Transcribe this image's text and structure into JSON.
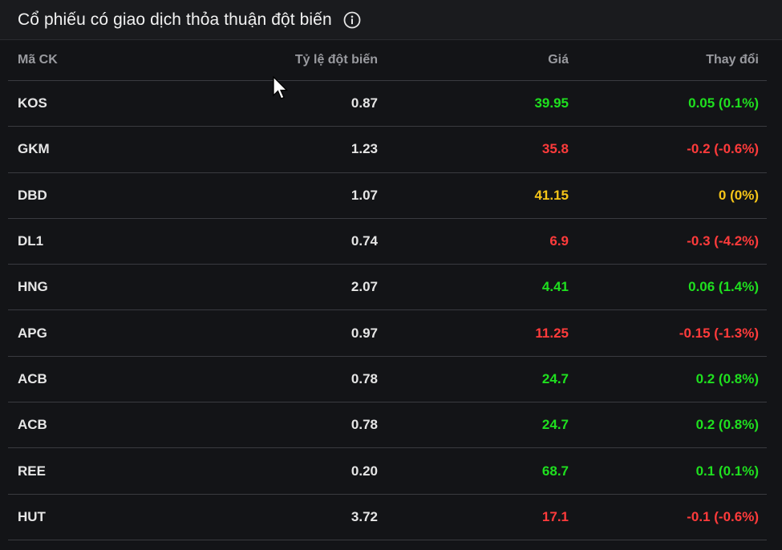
{
  "header": {
    "title": "Cổ phiếu có giao dịch thỏa thuận đột biến"
  },
  "columns": {
    "symbol": "Mã CK",
    "ratio": "Tỷ lệ đột biến",
    "price": "Giá",
    "change": "Thay đổi"
  },
  "colors": {
    "up": "#1fe01f",
    "down": "#ff3b3b",
    "reference": "#f5c518"
  },
  "rows": [
    {
      "symbol": "KOS",
      "ratio": "0.87",
      "price": "39.95",
      "change": "0.05 (0.1%)",
      "trend": "up"
    },
    {
      "symbol": "GKM",
      "ratio": "1.23",
      "price": "35.8",
      "change": "-0.2 (-0.6%)",
      "trend": "down"
    },
    {
      "symbol": "DBD",
      "ratio": "1.07",
      "price": "41.15",
      "change": "0 (0%)",
      "trend": "ref"
    },
    {
      "symbol": "DL1",
      "ratio": "0.74",
      "price": "6.9",
      "change": "-0.3 (-4.2%)",
      "trend": "down"
    },
    {
      "symbol": "HNG",
      "ratio": "2.07",
      "price": "4.41",
      "change": "0.06 (1.4%)",
      "trend": "up"
    },
    {
      "symbol": "APG",
      "ratio": "0.97",
      "price": "11.25",
      "change": "-0.15 (-1.3%)",
      "trend": "down"
    },
    {
      "symbol": "ACB",
      "ratio": "0.78",
      "price": "24.7",
      "change": "0.2 (0.8%)",
      "trend": "up"
    },
    {
      "symbol": "ACB",
      "ratio": "0.78",
      "price": "24.7",
      "change": "0.2 (0.8%)",
      "trend": "up"
    },
    {
      "symbol": "REE",
      "ratio": "0.20",
      "price": "68.7",
      "change": "0.1 (0.1%)",
      "trend": "up"
    },
    {
      "symbol": "HUT",
      "ratio": "3.72",
      "price": "17.1",
      "change": "-0.1 (-0.6%)",
      "trend": "down"
    }
  ]
}
